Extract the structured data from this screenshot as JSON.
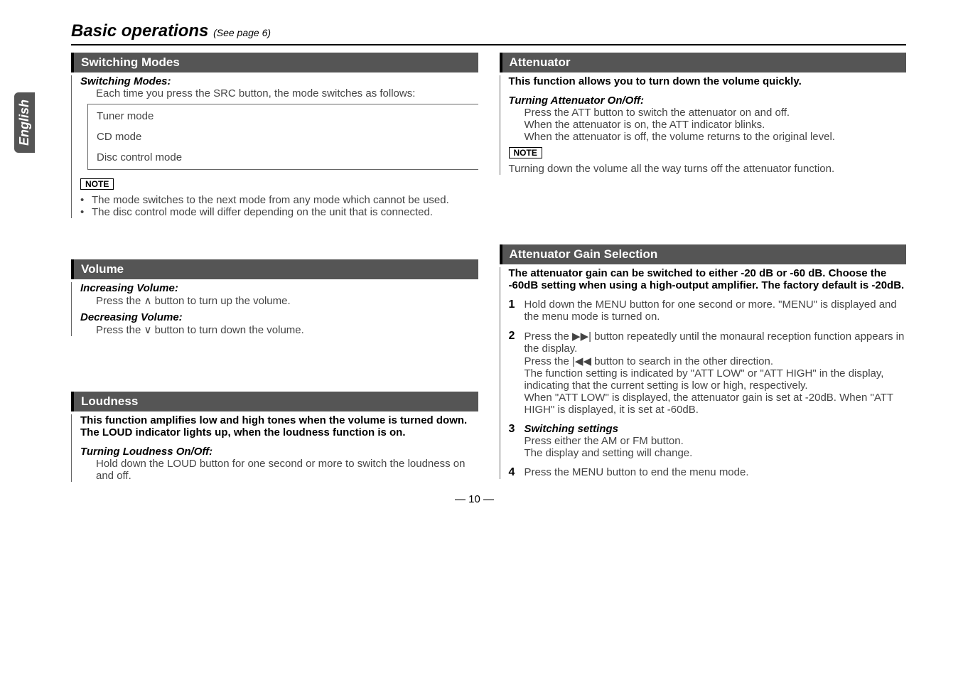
{
  "sideTab": "English",
  "title": "Basic operations",
  "titleSub": "(See page 6)",
  "left": {
    "switchingModes": {
      "header": "Switching Modes",
      "subheader": "Switching Modes:",
      "intro": "Each time you press the SRC button, the mode switches as follows:",
      "flow": [
        "Tuner mode",
        "CD mode",
        "Disc control mode"
      ],
      "noteLabel": "NOTE",
      "notes": [
        "The mode switches to the next mode from any mode which cannot be used.",
        "The disc control mode will differ depending on the unit that is connected."
      ]
    },
    "volume": {
      "header": "Volume",
      "inc": "Increasing Volume:",
      "incText": "Press the ∧ button to turn up the volume.",
      "dec": "Decreasing Volume:",
      "decText": "Press the ∨ button to turn down the volume."
    },
    "loudness": {
      "header": "Loudness",
      "intro1": "This function amplifies low and high tones when the volume is turned down.",
      "intro2": "The LOUD indicator lights up, when the loudness function is on.",
      "sub": "Turning Loudness On/Off:",
      "text": "Hold down the LOUD button for one second or more to switch the loudness on and off."
    }
  },
  "right": {
    "attenuator": {
      "header": "Attenuator",
      "intro": "This function allows you to turn down the volume quickly.",
      "sub": "Turning Attenuator On/Off:",
      "line1": "Press the ATT button to switch the attenuator on and off.",
      "line2": "When the attenuator is on, the ATT indicator blinks.",
      "line3": "When the attenuator is off, the volume returns to the original level.",
      "noteLabel": "NOTE",
      "noteText": "Turning down the volume all the way turns off the attenuator function."
    },
    "gain": {
      "header": "Attenuator Gain Selection",
      "intro": "The attenuator gain can be switched to either -20 dB or -60 dB. Choose the -60dB setting when using a high-output amplifier. The factory default is -20dB.",
      "step1": "Hold down the MENU button for one second or more. \"MENU\" is displayed and the menu mode is turned on.",
      "step2a": "Press the ▶▶| button repeatedly until the monaural reception function appears in the display.",
      "step2b": "Press the |◀◀ button to search in the other direction.",
      "step2c": "The function setting is indicated by \"ATT LOW\" or \"ATT HIGH\" in the display, indicating that the current setting is low or high, respectively.",
      "step2d": "When \"ATT LOW\" is displayed, the attenuator gain is set at -20dB. When \"ATT HIGH\" is displayed, it is set at -60dB.",
      "step3Title": "Switching settings",
      "step3a": "Press either the AM or FM button.",
      "step3b": "The display and setting will change.",
      "step4": "Press the MENU button to end the menu mode."
    }
  },
  "pageNum": "— 10 —"
}
